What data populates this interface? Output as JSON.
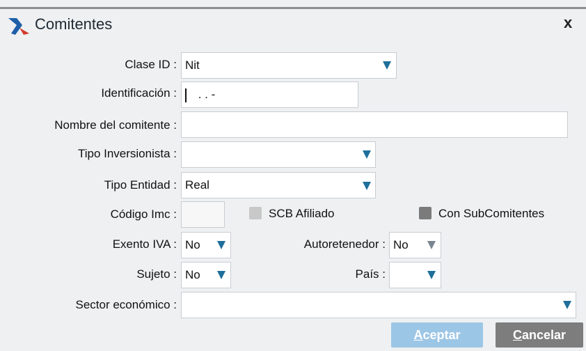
{
  "window": {
    "title": "Comitentes",
    "close_label": "x"
  },
  "fields": {
    "clase_id": {
      "label": "Clase ID :",
      "value": "Nit"
    },
    "identificacion": {
      "label": "Identificación :",
      "value": " .  .  -"
    },
    "nombre": {
      "label": "Nombre del comitente :",
      "value": ""
    },
    "tipo_inversionista": {
      "label": "Tipo Inversionista :",
      "value": ""
    },
    "tipo_entidad": {
      "label": "Tipo Entidad :",
      "value": "Real"
    },
    "codigo_imc": {
      "label": "Código Imc :",
      "value": ""
    },
    "scb_afiliado": {
      "label": "SCB Afiliado"
    },
    "con_subcomitentes": {
      "label": "Con SubComitentes"
    },
    "exento_iva": {
      "label": "Exento IVA :",
      "value": "No"
    },
    "autoretenedor": {
      "label": "Autoretenedor :",
      "value": "No"
    },
    "sujeto": {
      "label": "Sujeto :",
      "value": "No"
    },
    "pais": {
      "label": "País :",
      "value": ""
    },
    "sector_economico": {
      "label": "Sector económico :",
      "value": ""
    }
  },
  "buttons": {
    "aceptar": {
      "first": "A",
      "rest": "ceptar"
    },
    "cancelar": {
      "first": "C",
      "rest": "ancelar"
    }
  },
  "icons": {
    "logo": "app-logo-icon",
    "dropdown": "chevron-down-icon"
  },
  "colors": {
    "accent": "#1f6f9b",
    "aceptar_bg": "#9cc6e6",
    "cancelar_bg": "#7d7d7d",
    "checkbox": "#c8c8c8",
    "checkbox_checked": "#7b7b7b"
  }
}
